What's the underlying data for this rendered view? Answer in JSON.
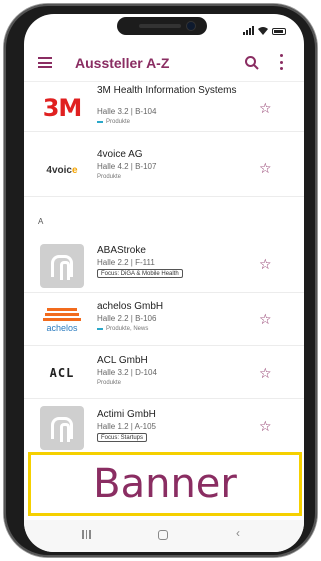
{
  "app": {
    "title": "Aussteller A-Z",
    "accent_color": "#8a2d62"
  },
  "icons": {
    "menu": "hamburger-menu-icon",
    "search": "search-icon",
    "more": "more-vertical-icon",
    "favorite": "star-outline-icon"
  },
  "section_header": "A",
  "exhibitors": [
    {
      "name": "3M Health Information Systems",
      "hall": "Halle 3.2 | B-104",
      "tag": "Produkte",
      "logo": "3M"
    },
    {
      "name": "4voice AG",
      "hall": "Halle 4.2 | B-107",
      "tag": "Produkte",
      "logo": "4voice"
    },
    {
      "name": "ABAStroke",
      "hall": "Halle 2.2 | F-111",
      "chip": "Focus: DiGA & Mobile Health",
      "logo": "placeholder"
    },
    {
      "name": "achelos GmbH",
      "hall": "Halle 2.2 | B-106",
      "tag": "Produkte, News",
      "logo": "achelos"
    },
    {
      "name": "ACL GmbH",
      "hall": "Halle 3.2 | D-104",
      "tag": "Produkte",
      "logo": "ACL"
    },
    {
      "name": "Actimi GmbH",
      "hall": "Halle 1.2 | A-105",
      "chip": "Focus: Startups",
      "logo": "placeholder"
    }
  ],
  "logos": {
    "3m": "3M",
    "fourvoice_a": "4voic",
    "fourvoice_b": "e",
    "achelos": "achelos",
    "acl": "ACL"
  },
  "banner": {
    "label": "Banner",
    "border_color": "#f5d000"
  },
  "system_nav": {
    "recent": "recent-apps-icon",
    "home": "home-icon",
    "back": "back-icon"
  }
}
